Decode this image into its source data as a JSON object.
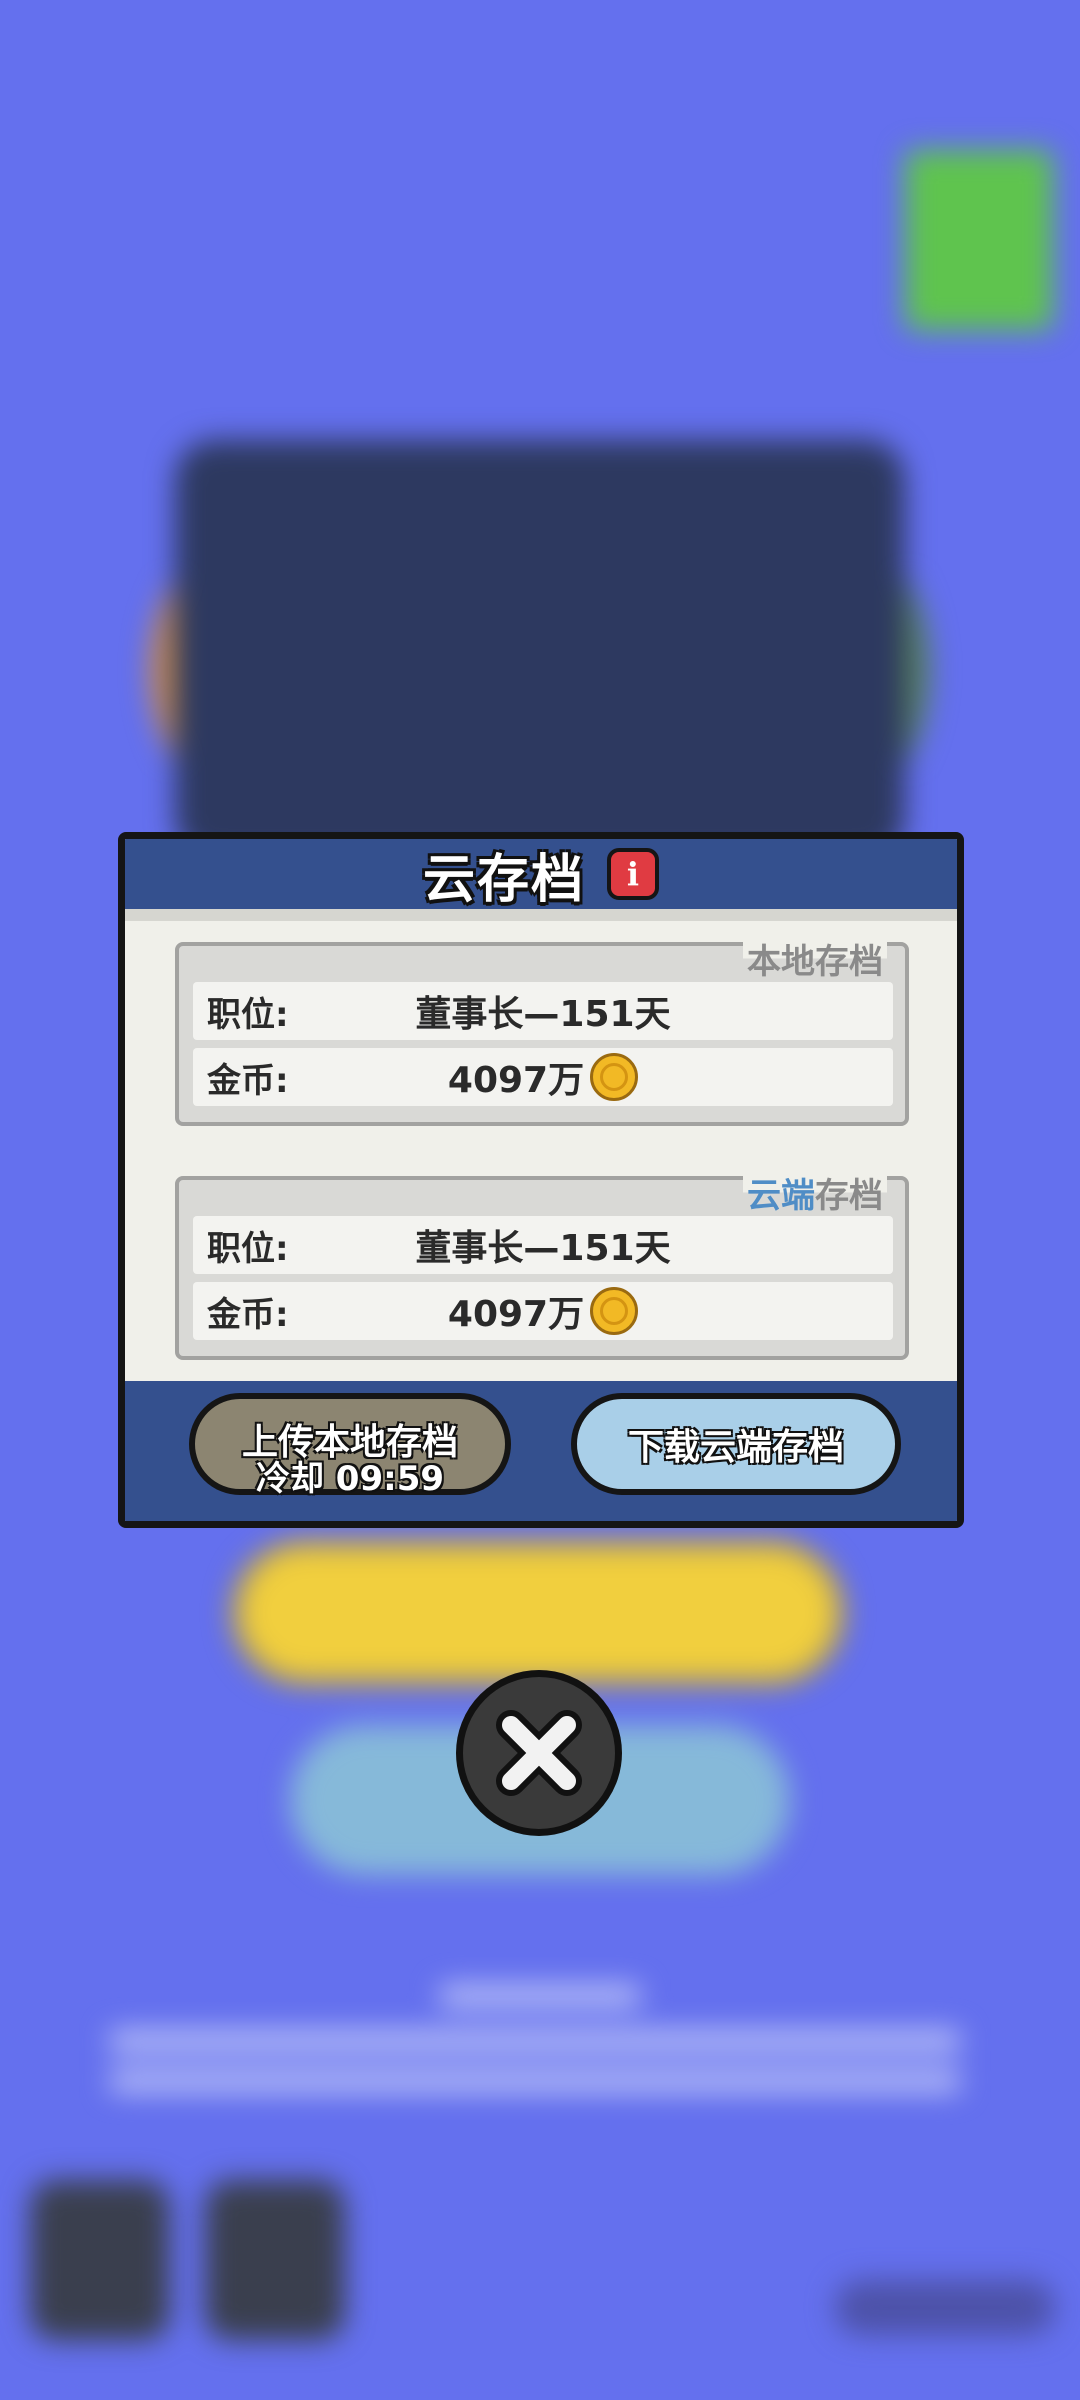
{
  "dialog": {
    "title": "云存档",
    "info_icon": "i",
    "local": {
      "label": "本地存档",
      "position_label": "职位:",
      "position_value": "董事长—151天",
      "gold_label": "金币:",
      "gold_value": "4097万"
    },
    "cloud": {
      "label_accent": "云端",
      "label_rest": "存档",
      "position_label": "职位:",
      "position_value": "董事长—151天",
      "gold_label": "金币:",
      "gold_value": "4097万"
    },
    "upload_button": "上传本地存档",
    "upload_cooldown": "冷却 09:59",
    "download_button": "下载云端存档"
  },
  "icons": {
    "coin": "coin-icon",
    "close": "close-icon",
    "info": "info-icon"
  },
  "colors": {
    "background": "#6470ee",
    "header": "#34508e",
    "accent_blue": "#4f8dc6",
    "info_red": "#e03b42",
    "coin_gold": "#f2b925"
  }
}
